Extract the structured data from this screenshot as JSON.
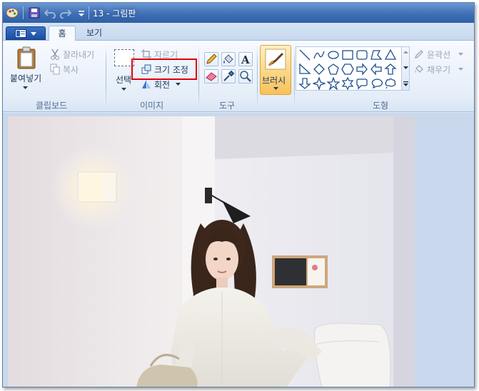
{
  "window": {
    "title": "13 - 그림판"
  },
  "tabs": [
    {
      "label": "홈"
    },
    {
      "label": "보기"
    }
  ],
  "clipboard": {
    "paste": "붙여넣기",
    "cut": "잘라내기",
    "copy": "복사",
    "group": "클립보드"
  },
  "image": {
    "select": "선택",
    "crop": "자르기",
    "resize": "크기 조정",
    "rotate": "회전",
    "group": "이미지"
  },
  "tools": {
    "group": "도구"
  },
  "brushes": {
    "label": "브러시"
  },
  "shapes": {
    "outline": "윤곽선",
    "fill": "채우기",
    "group": "도형"
  },
  "colors": {
    "highlight": "#e0000c",
    "accent": "#f5a623"
  }
}
